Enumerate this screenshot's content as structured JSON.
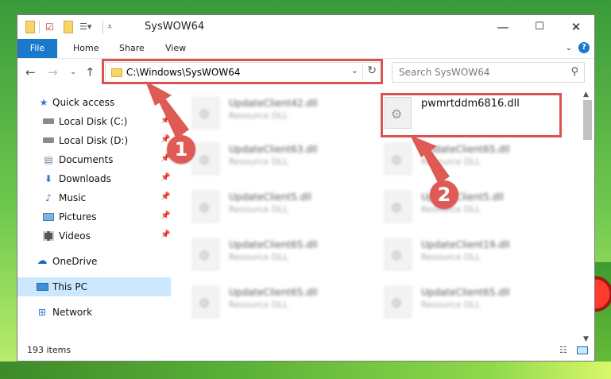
{
  "window": {
    "title": "SysWOW64",
    "minimize": "—",
    "maximize": "☐",
    "close": "✕"
  },
  "ribbon": {
    "file": "File",
    "home": "Home",
    "share": "Share",
    "view": "View"
  },
  "nav": {
    "address": "C:\\Windows\\SysWOW64",
    "search_placeholder": "Search SysWOW64"
  },
  "sidebar": {
    "items": [
      {
        "label": "Quick access",
        "icon": "star-icon"
      },
      {
        "label": "Local Disk (C:)",
        "icon": "drive-icon"
      },
      {
        "label": "Local Disk (D:)",
        "icon": "drive-icon"
      },
      {
        "label": "Documents",
        "icon": "documents-icon"
      },
      {
        "label": "Downloads",
        "icon": "download-icon"
      },
      {
        "label": "Music",
        "icon": "music-icon"
      },
      {
        "label": "Pictures",
        "icon": "pictures-icon"
      },
      {
        "label": "Videos",
        "icon": "videos-icon"
      },
      {
        "label": "OneDrive",
        "icon": "cloud-icon"
      },
      {
        "label": "This PC",
        "icon": "pc-icon"
      },
      {
        "label": "Network",
        "icon": "network-icon"
      }
    ]
  },
  "files": [
    {
      "name": "UpdateClient42.dll",
      "type": "Resource DLL"
    },
    {
      "name": "pwmrtddm6816.dll",
      "type": ""
    },
    {
      "name": "UpdateClient63.dll",
      "type": "Resource DLL"
    },
    {
      "name": "UpdateClient65.dll",
      "type": "Resource DLL"
    },
    {
      "name": "UpdateClient5.dll",
      "type": "Resource DLL"
    },
    {
      "name": "UpdateClient5.dll",
      "type": "Resource DLL"
    },
    {
      "name": "UpdateClient65.dll",
      "type": "Resource DLL"
    },
    {
      "name": "UpdateClient19.dll",
      "type": "Resource DLL"
    },
    {
      "name": "UpdateClient65.dll",
      "type": "Resource DLL"
    },
    {
      "name": "UpdateClient65.dll",
      "type": "Resource DLL"
    }
  ],
  "status": {
    "count": "193 items"
  },
  "callouts": {
    "one": "1",
    "two": "2"
  },
  "colors": {
    "accent": "#1979ca",
    "highlight": "#d9534f",
    "selected": "#cce8ff"
  }
}
